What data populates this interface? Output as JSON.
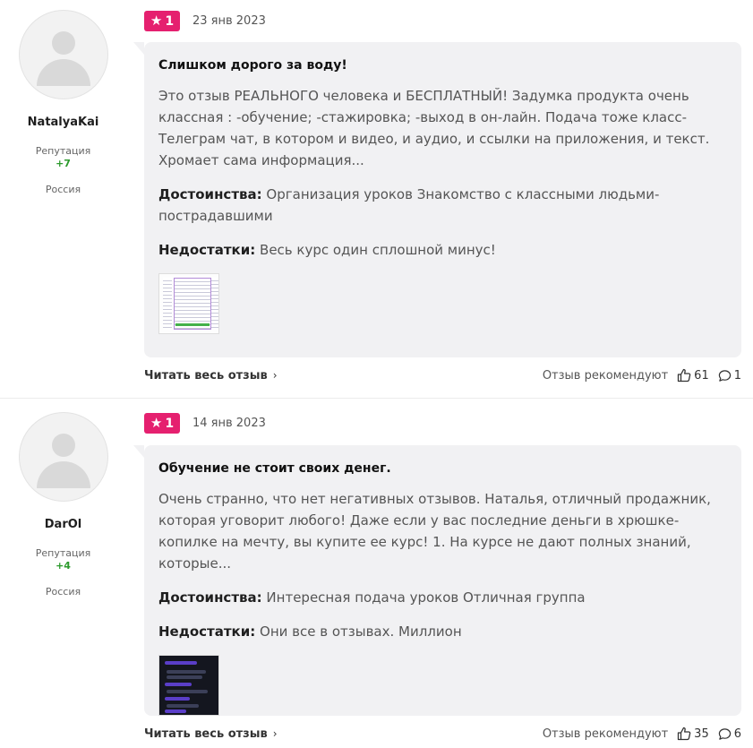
{
  "reviews": [
    {
      "author": {
        "name": "NatalyaKai",
        "reputation_label": "Репутация",
        "reputation_value": "+7",
        "country": "Россия"
      },
      "rating": "1",
      "date": "23 янв 2023",
      "title": "Слишком дорого за воду!",
      "text": "Это отзыв РЕАЛЬНОГО человека и БЕСПЛАТНЫЙ! Задумка продукта очень классная : -обучение; -стажировка; -выход в он-лайн. Подача тоже класс- Телеграм чат, в котором и видео, и аудио, и ссылки на приложения, и текст. Хромает сама информация...",
      "pros_label": "Достоинства:",
      "pros": "Организация уроков Знакомство с классными людьми-пострадавшими",
      "cons_label": "Недостатки:",
      "cons": "Весь курс один сплошной минус!",
      "read_more": "Читать весь отзыв",
      "recommend_label": "Отзыв рекомендуют",
      "likes": "61",
      "comments": "1"
    },
    {
      "author": {
        "name": "DarOl",
        "reputation_label": "Репутация",
        "reputation_value": "+4",
        "country": "Россия"
      },
      "rating": "1",
      "date": "14 янв 2023",
      "title": "Обучение не стоит своих денег.",
      "text": "Очень странно, что нет негативных отзывов. Наталья, отличный продажник, которая уговорит любого! Даже если у вас последние деньги в хрюшке-копилке на мечту, вы купите ее курс! 1. На курсе не дают полных знаний, которые...",
      "pros_label": "Достоинства:",
      "pros": "Интересная подача уроков Отличная группа",
      "cons_label": "Недостатки:",
      "cons": "Они все в отзывах. Миллион",
      "read_more": "Читать весь отзыв",
      "recommend_label": "Отзыв рекомендуют",
      "likes": "35",
      "comments": "6"
    }
  ],
  "colors": {
    "badge": "#e5206f",
    "reputation": "#2c9a2c",
    "card_bg": "#f1f1f3"
  },
  "icons": {
    "rating": "star-icon",
    "read_more": "chevron-right-icon",
    "likes": "thumbs-up-icon",
    "comments": "comment-bubble-icon",
    "avatar": "user-avatar-placeholder-icon"
  }
}
